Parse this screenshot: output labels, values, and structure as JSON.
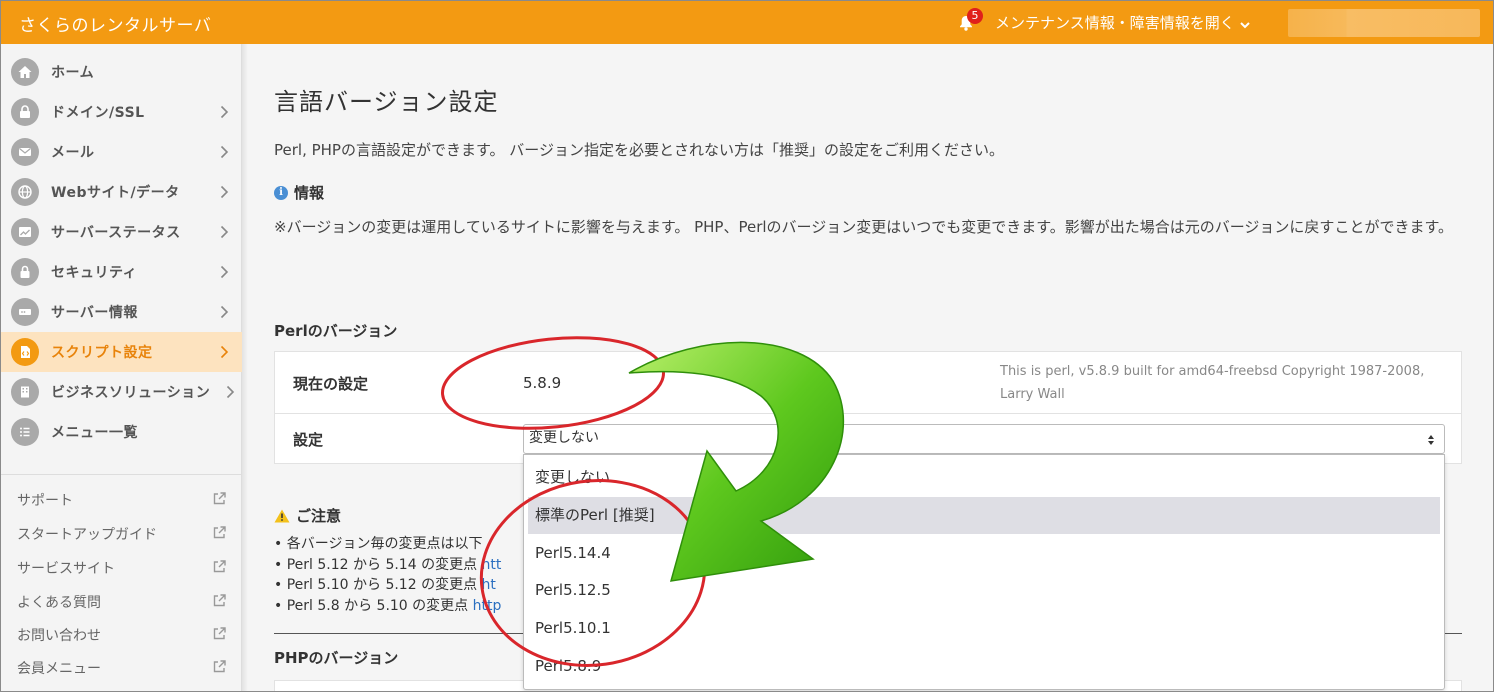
{
  "header": {
    "brand": "さくらのレンタルサーバ",
    "notice_count": "5",
    "notice_label": "メンテナンス情報・障害情報を開く"
  },
  "sidebar": {
    "items": [
      {
        "label": "ホーム",
        "icon": "home-icon"
      },
      {
        "label": "ドメイン/SSL",
        "icon": "domain-icon"
      },
      {
        "label": "メール",
        "icon": "mail-icon"
      },
      {
        "label": "Webサイト/データ",
        "icon": "globe-icon"
      },
      {
        "label": "サーバーステータス",
        "icon": "chart-icon"
      },
      {
        "label": "セキュリティ",
        "icon": "lock-icon"
      },
      {
        "label": "サーバー情報",
        "icon": "server-icon"
      },
      {
        "label": "スクリプト設定",
        "icon": "script-icon"
      },
      {
        "label": "ビジネスソリューション",
        "icon": "building-icon"
      },
      {
        "label": "メニュー一覧",
        "icon": "list-icon"
      }
    ],
    "links": [
      "サポート",
      "スタートアップガイド",
      "サービスサイト",
      "よくある質問",
      "お問い合わせ",
      "会員メニュー"
    ]
  },
  "main": {
    "title": "言語バージョン設定",
    "description": "Perl, PHPの言語設定ができます。 バージョン指定を必要とされない方は「推奨」の設定をご利用ください。",
    "info_heading": "情報",
    "info_text": "※バージョンの変更は運用しているサイトに影響を与えます。 PHP、Perlのバージョン変更はいつでも変更できます。影響が出た場合は元のバージョンに戻すことができます。",
    "perl_heading": "Perlのバージョン",
    "current_label": "現在の設定",
    "current_value": "5.8.9",
    "perl_info": "This is perl, v5.8.9 built for amd64-freebsd Copyright 1987-2008, Larry Wall",
    "setting_label": "設定",
    "select_value": "変更しない",
    "options": [
      "変更しない",
      "標準のPerl [推奨]",
      "Perl5.14.4",
      "Perl5.12.5",
      "Perl5.10.1",
      "Perl5.8.9"
    ],
    "caution_heading": "ご注意",
    "caution_items": [
      {
        "text": "各バージョン毎の変更点は以下",
        "link": ""
      },
      {
        "text": "Perl 5.12 から 5.14 の変更点 ",
        "link": "htt"
      },
      {
        "text": "Perl 5.10 から 5.12 の変更点 ",
        "link": "ht"
      },
      {
        "text": "Perl 5.8 から 5.10 の変更点 ",
        "link": "http"
      }
    ],
    "php_heading": "PHPのバージョン"
  },
  "colors": {
    "header": "#f39a12",
    "active_bg": "#fde3bf",
    "annotation_red": "#d9262b",
    "annotation_arrow": "#5cc21a"
  }
}
